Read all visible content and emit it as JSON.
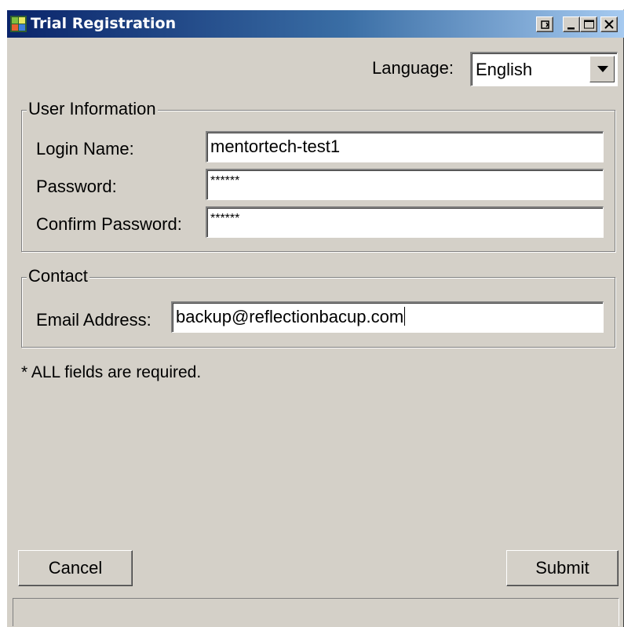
{
  "window": {
    "title": "Trial Registration",
    "title_icon": "java-app-icon",
    "controls": [
      "restore-icon",
      "minimize-icon",
      "maximize-icon",
      "close-icon"
    ]
  },
  "language": {
    "label": "Language:",
    "selected": "English"
  },
  "user_information": {
    "title": "User Information",
    "login_label": "Login Name:",
    "login_value": "mentortech-test1",
    "password_label": "Password:",
    "password_value": "******",
    "confirm_label": "Confirm Password:",
    "confirm_value": "******"
  },
  "contact": {
    "title": "Contact",
    "email_label": "Email Address:",
    "email_value": "backup@reflectionbacup.com"
  },
  "note": "* ALL fields are required.",
  "buttons": {
    "cancel": "Cancel",
    "submit": "Submit"
  },
  "colors": {
    "window_bg": "#d4d0c8",
    "title_start": "#0a246a",
    "title_end": "#a6caf0"
  }
}
